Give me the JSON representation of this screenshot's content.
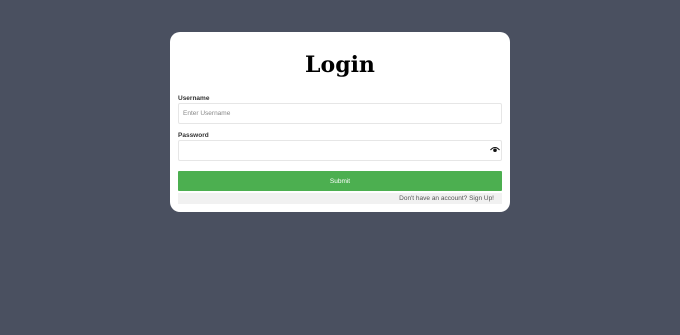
{
  "login": {
    "title": "Login",
    "username_label": "Username",
    "username_placeholder": "Enter Username",
    "username_value": "",
    "password_label": "Password",
    "password_value": "",
    "submit_label": "Submit",
    "signup_prompt": "Don't have an account?",
    "signup_link": "Sign Up!",
    "password_toggle_icon": "eye-icon"
  },
  "colors": {
    "background": "#4a5060",
    "card": "#ffffff",
    "submit_button": "#4caf50",
    "signup_bar": "#f1f1f1"
  }
}
